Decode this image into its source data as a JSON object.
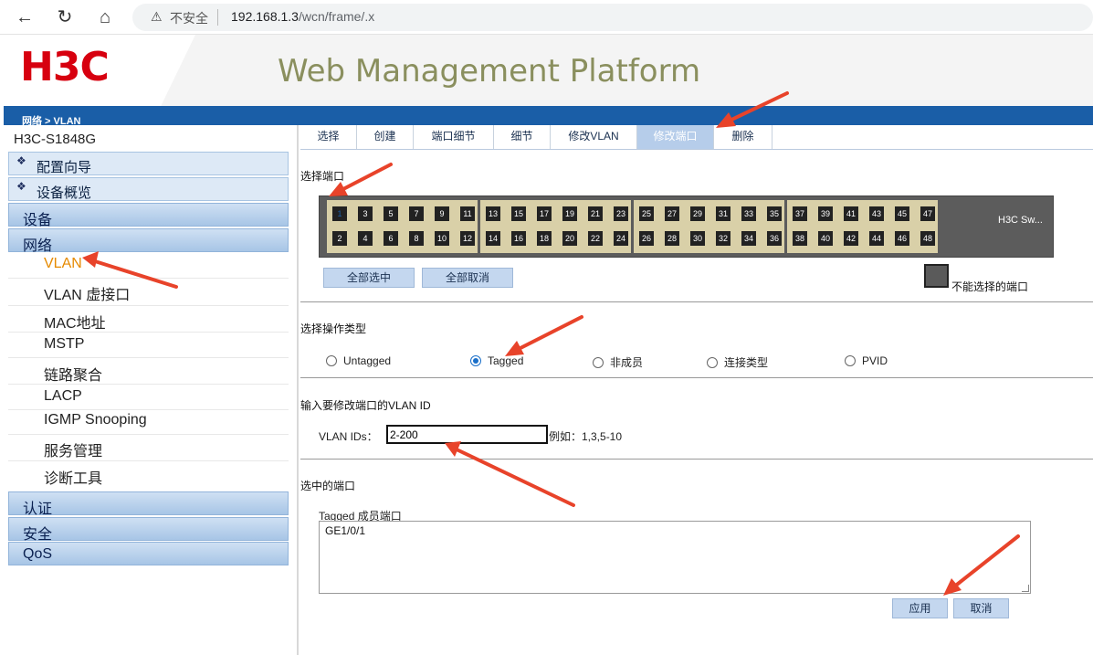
{
  "browser": {
    "warning_label": "不安全",
    "url_host": "192.168.1.3",
    "url_path": "/wcn/frame/.x"
  },
  "header": {
    "logo": "H3C",
    "platform_title": "Web Management Platform",
    "breadcrumb": "网络 > VLAN",
    "colors": {
      "logo": "#d7000f",
      "bar": "#1a5ea7",
      "title": "#8a8f5e"
    }
  },
  "sidebar": {
    "device_name": "H3C-S1848G",
    "blocks": [
      {
        "label": "配置向导"
      },
      {
        "label": "设备概览"
      }
    ],
    "categories": [
      {
        "label": "设备"
      },
      {
        "label": "网络"
      },
      {
        "label": "认证"
      },
      {
        "label": "安全"
      },
      {
        "label": "QoS"
      }
    ],
    "network_items": [
      {
        "label": "VLAN",
        "active": true
      },
      {
        "label": "VLAN 虚接口"
      },
      {
        "label": "MAC地址"
      },
      {
        "label": "MSTP"
      },
      {
        "label": "链路聚合"
      },
      {
        "label": "LACP"
      },
      {
        "label": "IGMP Snooping"
      },
      {
        "label": "服务管理"
      },
      {
        "label": "诊断工具"
      }
    ]
  },
  "tabs": [
    {
      "label": "选择"
    },
    {
      "label": "创建"
    },
    {
      "label": "端口细节"
    },
    {
      "label": "细节"
    },
    {
      "label": "修改VLAN"
    },
    {
      "label": "修改端口",
      "active": true
    },
    {
      "label": "删除"
    }
  ],
  "port_section": {
    "title": "选择端口",
    "device_label": "H3C Sw...",
    "top_ports": [
      "1",
      "3",
      "5",
      "7",
      "9",
      "11",
      "13",
      "15",
      "17",
      "19",
      "21",
      "23",
      "25",
      "27",
      "29",
      "31",
      "33",
      "35",
      "37",
      "39",
      "41",
      "43",
      "45",
      "47"
    ],
    "bottom_ports": [
      "2",
      "4",
      "6",
      "8",
      "10",
      "12",
      "14",
      "16",
      "18",
      "20",
      "22",
      "24",
      "26",
      "28",
      "30",
      "32",
      "34",
      "36",
      "38",
      "40",
      "42",
      "44",
      "46",
      "48"
    ],
    "selected_port": "1",
    "select_all": "全部选中",
    "deselect_all": "全部取消",
    "legend": "不能选择的端口"
  },
  "op_section": {
    "title": "选择操作类型",
    "options": [
      {
        "label": "Untagged",
        "checked": false
      },
      {
        "label": "Tagged",
        "checked": true
      },
      {
        "label": "非成员",
        "checked": false
      },
      {
        "label": "连接类型",
        "checked": false
      },
      {
        "label": "PVID",
        "checked": false
      }
    ]
  },
  "vlan_section": {
    "title": "输入要修改端口的VLAN ID",
    "label": "VLAN IDs：",
    "value": "2-200",
    "example": "例如：1,3,5-10"
  },
  "selected_section": {
    "title": "选中的端口",
    "box_label": "Tagged 成员端口",
    "box_value": "GE1/0/1"
  },
  "actions": {
    "apply": "应用",
    "cancel": "取消"
  }
}
